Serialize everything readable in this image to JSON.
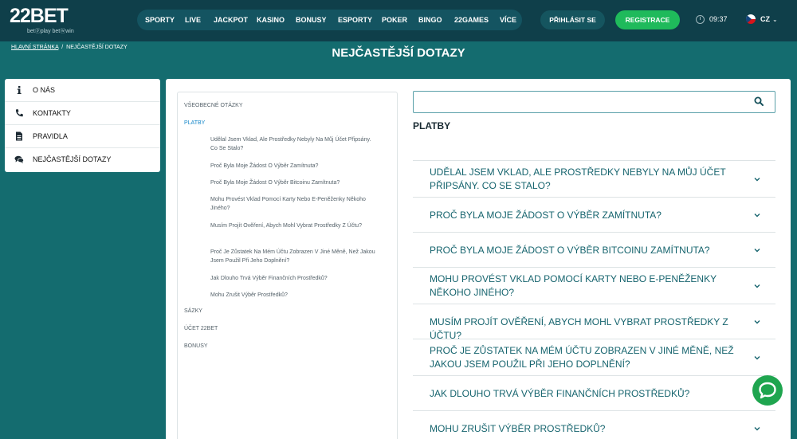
{
  "header": {
    "logo_main": "22BET",
    "logo_sub": "betⓟplay betⓦwin",
    "nav": [
      "SPORTY",
      "LIVE",
      "JACKPOT",
      "KASINO",
      "BONUSY",
      "ESPORTY",
      "POKER",
      "BINGO",
      "22GAMES",
      "VÍCE"
    ],
    "login_label": "PŘIHLÁSIT SE",
    "register_label": "REGISTRACE",
    "time": "09:37",
    "language": "CZ"
  },
  "breadcrumb": {
    "home": "HLAVNÍ STRÁNKA",
    "separator": "/",
    "current": "NEJČASTĚJŠÍ DOTAZY"
  },
  "page_title": "NEJČASTĚJŠÍ DOTAZY",
  "left_menu": [
    {
      "label": "O NÁS",
      "icon": "info-icon"
    },
    {
      "label": "KONTAKTY",
      "icon": "phone-icon"
    },
    {
      "label": "PRAVIDLA",
      "icon": "document-icon"
    },
    {
      "label": "NEJČASTĚJŠÍ DOTAZY",
      "icon": "chat-bubbles-icon"
    }
  ],
  "toc": {
    "categories": [
      "VŠEOBECNÉ OTÁZKY",
      "PLATBY",
      "SÁZKY",
      "ÚČET 22BET",
      "BONUSY"
    ],
    "questions": [
      "Udělal Jsem Vklad, Ale Prostředky Nebyly Na Můj Účet Připsány. Co Se Stalo?",
      "Proč Byla Moje Žádost O Výběr Zamítnuta?",
      "Proč Byla Moje Žádost O Výběr Bitcoinu Zamítnuta?",
      "Mohu Provést Vklad Pomocí Karty Nebo E-Peněženky Někoho Jiného?",
      "Musím Projít Ověření, Abych Mohl Vybrat Prostředky Z Účtu?",
      "Proč Je Zůstatek Na Mém Účtu Zobrazen V Jiné Měně, Než Jakou Jsem Použil Při Jeho Doplnění?",
      "Jak Dlouho Trvá Výběr Finančních Prostředků?",
      "Mohu Zrušit Výběr Prostředků?"
    ]
  },
  "search": {
    "placeholder": ""
  },
  "section_title": "PLATBY",
  "faq": [
    "UDĚLAL JSEM VKLAD, ALE PROSTŘEDKY NEBYLY NA MŮJ ÚČET PŘIPSÁNY. CO SE STALO?",
    "PROČ BYLA MOJE ŽÁDOST O VÝBĚR ZAMÍTNUTA?",
    "PROČ BYLA MOJE ŽÁDOST O VÝBĚR BITCOINU ZAMÍTNUTA?",
    "MOHU PROVÉST VKLAD POMOCÍ KARTY NEBO E-PENĚŽENKY NĚKOHO JINÉHO?",
    "MUSÍM PROJÍT OVĚŘENÍ, ABYCH MOHL VYBRAT PROSTŘEDKY Z ÚČTU?",
    "PROČ JE ZŮSTATEK NA MÉM ÚČTU ZOBRAZEN V JINÉ MĚNĚ, NEŽ JAKOU JSEM POUŽIL PŘI JEHO DOPLNĚNÍ?",
    "JAK DLOUHO TRVÁ VÝBĚR FINANČNÍCH PROSTŘEDKŮ?",
    "MOHU ZRUŠIT VÝBĚR PROSTŘEDKŮ?"
  ],
  "colors": {
    "background": "#146c6f",
    "header": "#0f3f4a",
    "accent_green": "#1fba5b",
    "link_blue": "#1788c9",
    "faq_text": "#16646e"
  }
}
